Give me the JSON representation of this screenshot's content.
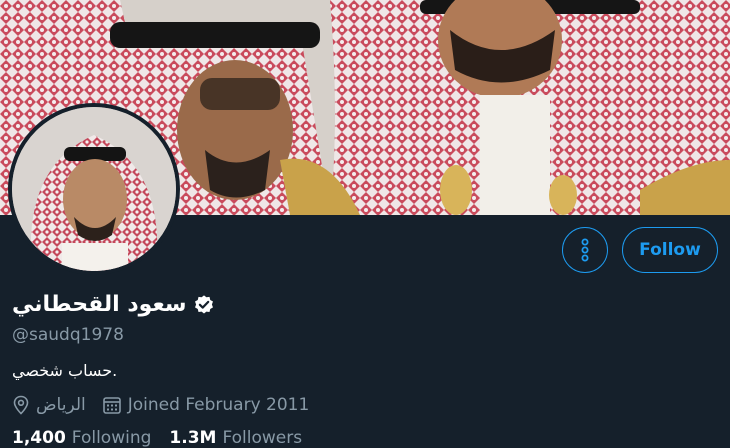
{
  "profile": {
    "display_name": "سعود القحطاني",
    "handle": "@saudq1978",
    "bio": "حساب شخصي.",
    "location": "الرياض",
    "joined": "Joined February 2011",
    "verified_icon": "verified-badge-icon"
  },
  "actions": {
    "more_icon": "more-vertical-icon",
    "follow_label": "Follow"
  },
  "stats": {
    "following_count": "1,400",
    "following_label": "Following",
    "followers_count": "1.3M",
    "followers_label": "Followers"
  },
  "colors": {
    "background": "#15202b",
    "accent": "#1d9bf0",
    "muted": "#8899a6"
  }
}
